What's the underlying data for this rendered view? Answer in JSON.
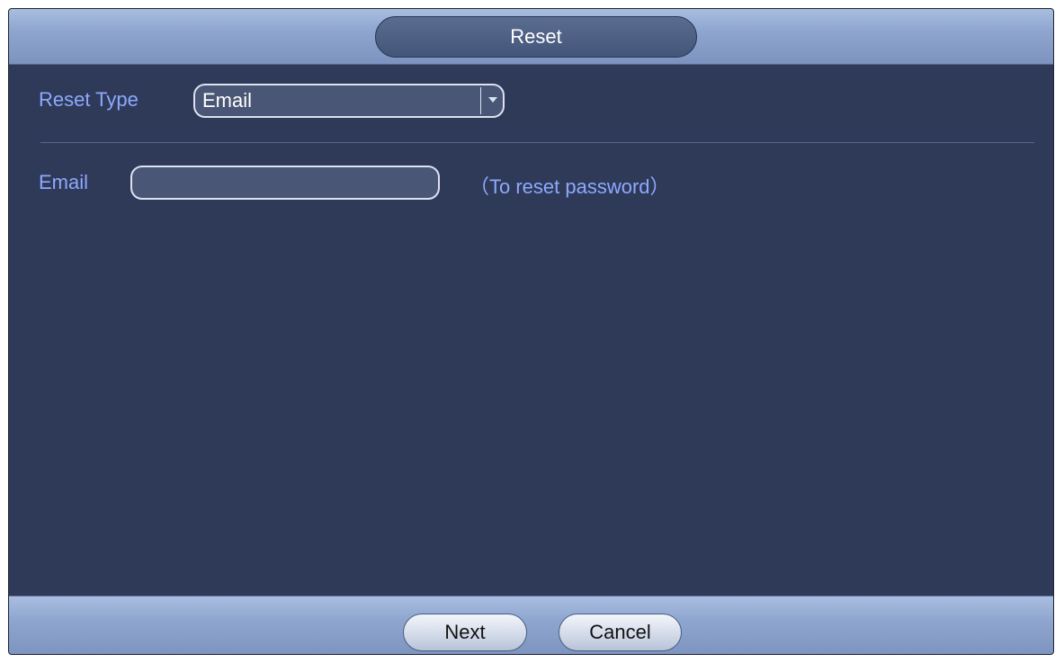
{
  "dialog": {
    "title": "Reset"
  },
  "form": {
    "reset_type_label": "Reset Type",
    "reset_type_value": "Email",
    "email_label": "Email",
    "email_value": "",
    "email_hint": "（To reset password）"
  },
  "footer": {
    "next_label": "Next",
    "cancel_label": "Cancel"
  },
  "icons": {
    "dropdown": "chevron-down-icon"
  },
  "colors": {
    "label": "#8ea8ff",
    "panel": "#2f3a58",
    "bar": "#8ea6cf"
  }
}
